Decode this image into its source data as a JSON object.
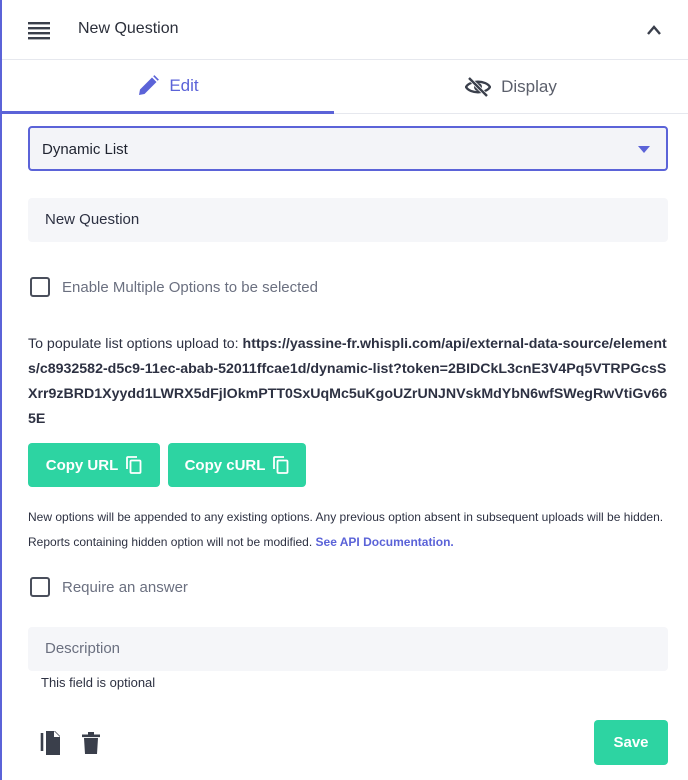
{
  "header": {
    "title": "New Question"
  },
  "tabs": [
    {
      "label": "Edit",
      "icon": "pencil-icon",
      "active": true
    },
    {
      "label": "Display",
      "icon": "eye-slash-icon",
      "active": false
    }
  ],
  "question_type": {
    "value": "Dynamic List"
  },
  "question_field": {
    "value": "New Question"
  },
  "multiple_options": {
    "label": "Enable Multiple Options to be selected",
    "checked": false
  },
  "upload": {
    "prefix": "To populate list options upload to: ",
    "url": "https://yassine-fr.whispli.com/api/external-data-source/elements/c8932582-d5c9-11ec-abab-52011ffcae1d/dynamic-list?token=2BIDCkL3cnE3V4Pq5VTRPGcsSXrr9zBRD1Xyydd1LWRX5dFjlOkmPTT0SxUqMc5uKgoUZrUNJNVskMdYbN6wfSWegRwVtiGv665E"
  },
  "buttons": {
    "copy_url": "Copy URL",
    "copy_curl": "Copy cURL",
    "save": "Save"
  },
  "notes": {
    "text": "New options will be appended to any existing options. Any previous option absent in subsequent uploads will be hidden. Reports containing hidden option will not be modified. ",
    "link": "See API Documentation."
  },
  "require_answer": {
    "label": "Require an answer",
    "checked": false
  },
  "description": {
    "placeholder": "Description",
    "helper": "This field is optional"
  },
  "colors": {
    "accent": "#5b63d8",
    "success": "#2dd4a2"
  }
}
